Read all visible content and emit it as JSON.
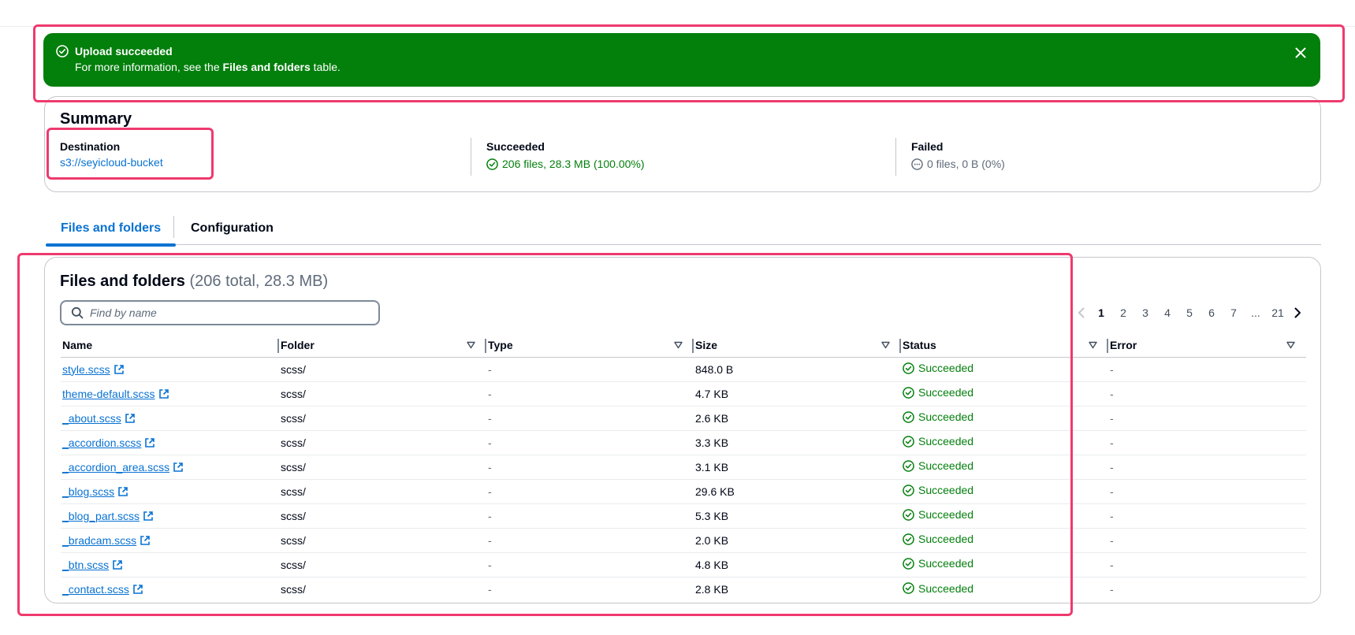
{
  "flash": {
    "title": "Upload succeeded",
    "msg_pre": "For more information, see the ",
    "msg_bold": "Files and folders",
    "msg_post": " table."
  },
  "summary": {
    "title": "Summary",
    "destination_label": "Destination",
    "destination_value": "s3://seyicloud-bucket",
    "succeeded_label": "Succeeded",
    "succeeded_value": "206 files, 28.3 MB (100.00%)",
    "failed_label": "Failed",
    "failed_value": "0 files, 0 B (0%)"
  },
  "tabs": [
    {
      "label": "Files and folders",
      "active": true
    },
    {
      "label": "Configuration",
      "active": false
    }
  ],
  "files": {
    "title": "Files and folders",
    "count": "(206 total, 28.3 MB)",
    "search_placeholder": "Find by name",
    "pagination": [
      "1",
      "2",
      "3",
      "4",
      "5",
      "6",
      "7",
      "...",
      "21"
    ],
    "columns": [
      "Name",
      "Folder",
      "Type",
      "Size",
      "Status",
      "Error"
    ],
    "rows": [
      {
        "name": "style.scss",
        "folder": "scss/",
        "type": "-",
        "size": "848.0 B",
        "status": "Succeeded",
        "error": "-"
      },
      {
        "name": "theme-default.scss",
        "folder": "scss/",
        "type": "-",
        "size": "4.7 KB",
        "status": "Succeeded",
        "error": "-"
      },
      {
        "name": "_about.scss",
        "folder": "scss/",
        "type": "-",
        "size": "2.6 KB",
        "status": "Succeeded",
        "error": "-"
      },
      {
        "name": "_accordion.scss",
        "folder": "scss/",
        "type": "-",
        "size": "3.3 KB",
        "status": "Succeeded",
        "error": "-"
      },
      {
        "name": "_accordion_area.scss",
        "folder": "scss/",
        "type": "-",
        "size": "3.1 KB",
        "status": "Succeeded",
        "error": "-"
      },
      {
        "name": "_blog.scss",
        "folder": "scss/",
        "type": "-",
        "size": "29.6 KB",
        "status": "Succeeded",
        "error": "-"
      },
      {
        "name": "_blog_part.scss",
        "folder": "scss/",
        "type": "-",
        "size": "5.3 KB",
        "status": "Succeeded",
        "error": "-"
      },
      {
        "name": "_bradcam.scss",
        "folder": "scss/",
        "type": "-",
        "size": "2.0 KB",
        "status": "Succeeded",
        "error": "-"
      },
      {
        "name": "_btn.scss",
        "folder": "scss/",
        "type": "-",
        "size": "4.8 KB",
        "status": "Succeeded",
        "error": "-"
      },
      {
        "name": "_contact.scss",
        "folder": "scss/",
        "type": "-",
        "size": "2.8 KB",
        "status": "Succeeded",
        "error": "-"
      }
    ]
  },
  "colors": {
    "success": "#037f0c",
    "link": "#0972d3",
    "highlight": "#ee3a6e"
  }
}
